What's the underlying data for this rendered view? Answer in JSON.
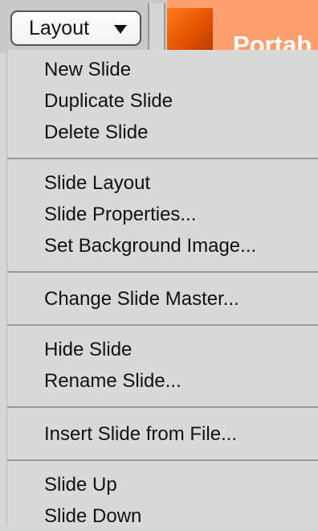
{
  "toolbar": {
    "layout_button_label": "Layout",
    "thumbnail_title": "Portab"
  },
  "menu": {
    "items": [
      {
        "label": "New Slide"
      },
      {
        "label": "Duplicate Slide"
      },
      {
        "label": "Delete Slide"
      },
      {
        "label": "Slide Layout"
      },
      {
        "label": "Slide Properties..."
      },
      {
        "label": "Set Background Image..."
      },
      {
        "label": "Change Slide Master..."
      },
      {
        "label": "Hide Slide"
      },
      {
        "label": "Rename Slide..."
      },
      {
        "label": "Insert Slide from File..."
      },
      {
        "label": "Slide Up"
      },
      {
        "label": "Slide Down"
      }
    ]
  }
}
